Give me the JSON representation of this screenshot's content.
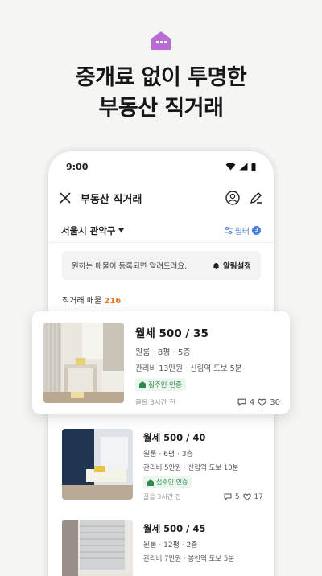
{
  "headline": {
    "line1": "중개료 없이 투명한",
    "line2": "부동산 직거래"
  },
  "accent_color": "#b96bd6",
  "status_bar": {
    "time": "9:00"
  },
  "app_bar": {
    "title": "부동산 직거래"
  },
  "location": {
    "label": "서울시 관악구",
    "filter_label": "필터",
    "filter_count": "3"
  },
  "alert": {
    "text": "원하는 매물이 등록되면 알려드려요.",
    "button": "알림설정"
  },
  "count": {
    "label": "직거래 매물",
    "value": "216"
  },
  "listings": [
    {
      "price": "월세 500 / 35",
      "specs": "원룸 · 8평 · 5층",
      "detail": "관리비 13만원 · 신림역 도보 5분",
      "badge": "집주인 인증",
      "time": "끌올 3시간 전",
      "chats": "4",
      "likes": "30"
    },
    {
      "price": "월세 500 / 40",
      "specs": "원룸 · 6평 · 3층",
      "detail": "관리비 5만원 · 신림역 도보 10분",
      "badge": "집주인 인증",
      "time": "끌올 3시간 전",
      "chats": "5",
      "likes": "17"
    },
    {
      "price": "월세 500 / 45",
      "specs": "원룸 · 12평 · 2층",
      "detail": "관리비 7만원 · 봉천역 도보 5분"
    }
  ]
}
